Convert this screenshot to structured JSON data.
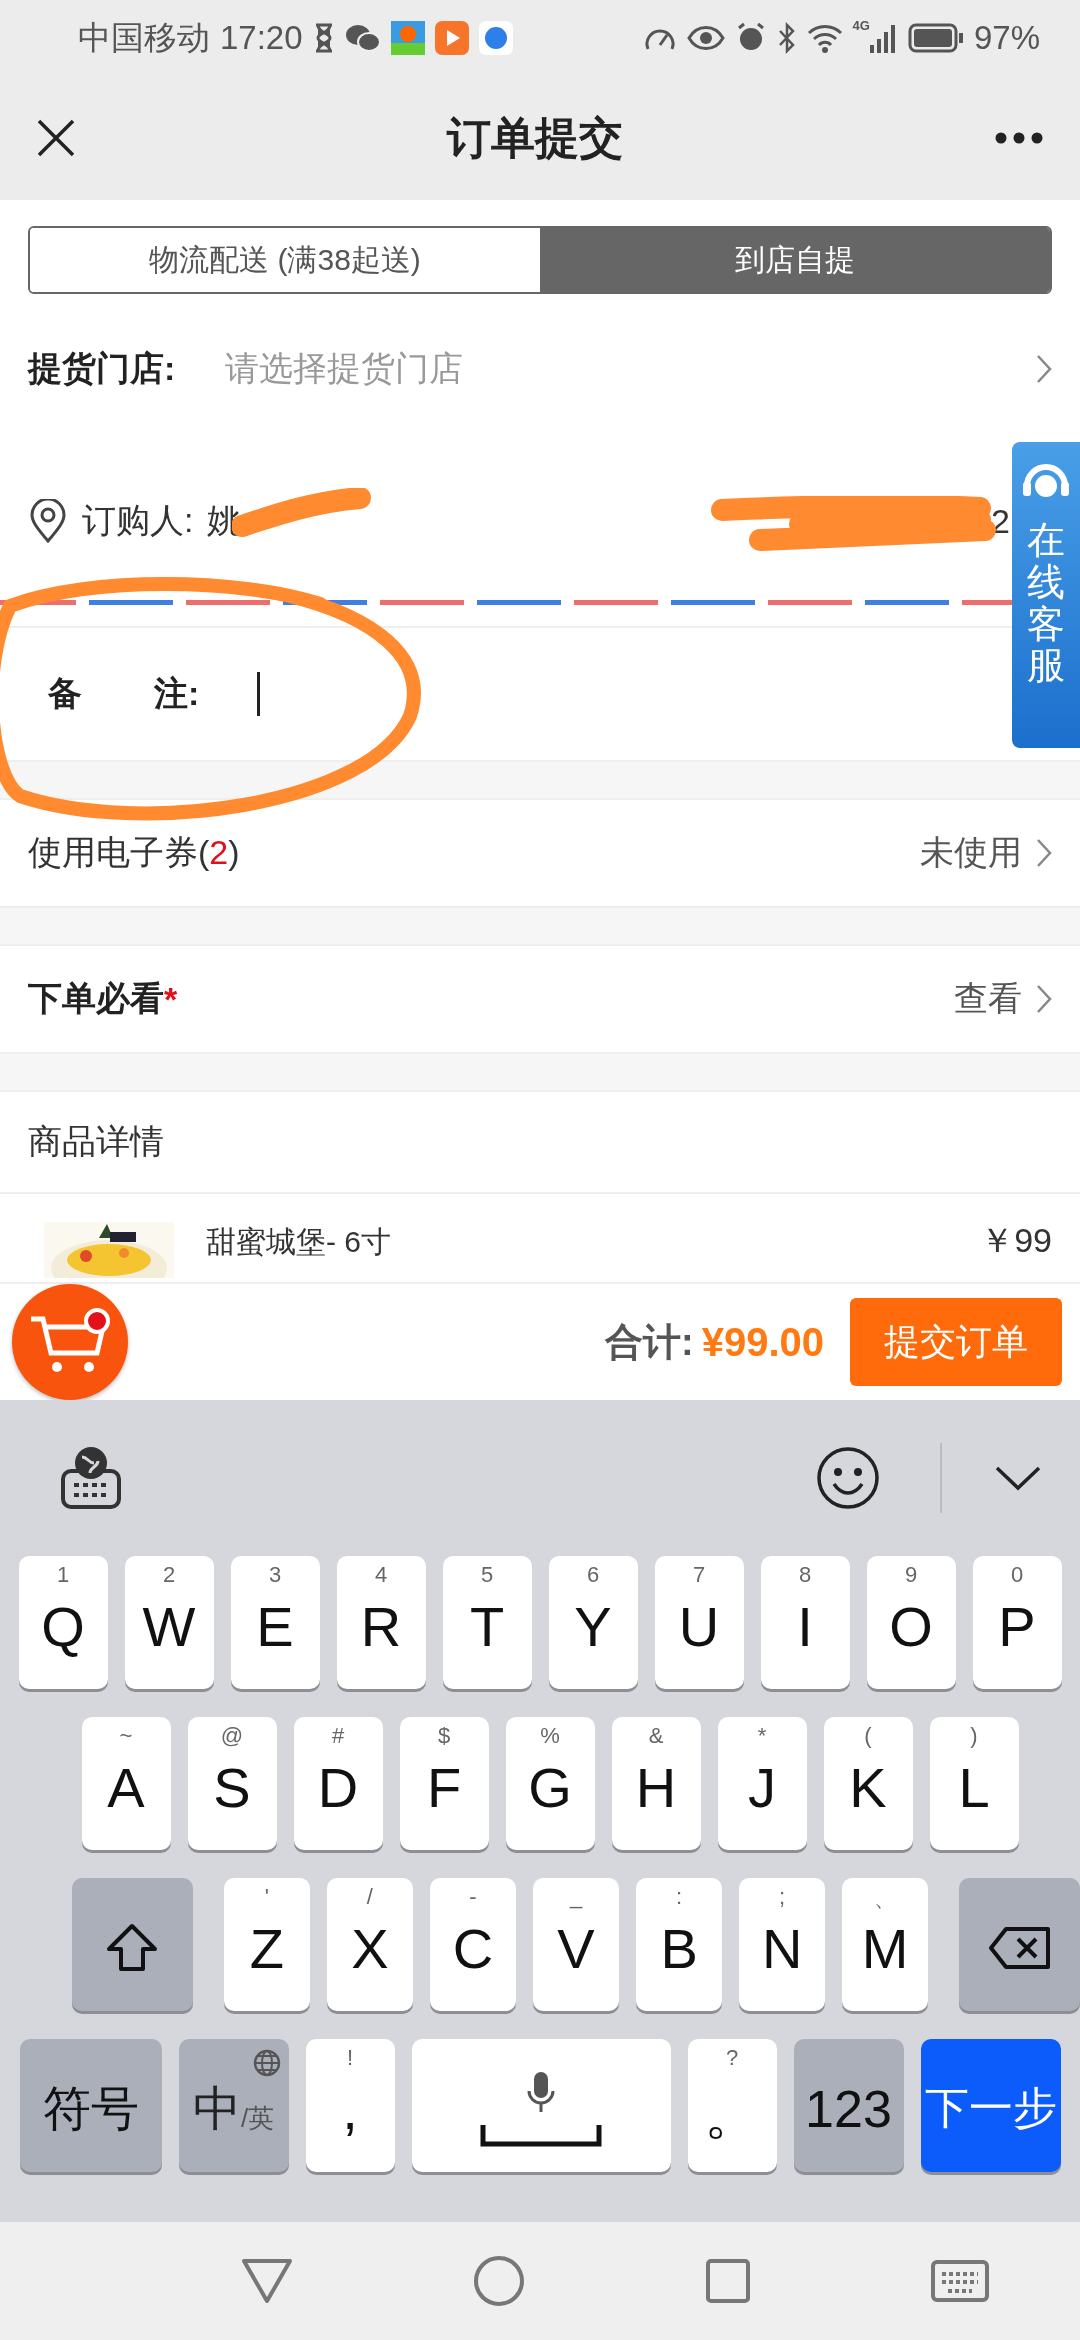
{
  "status_bar": {
    "carrier": "中国移动",
    "time": "17:20",
    "network": "4G",
    "battery": "97%"
  },
  "header": {
    "title": "订单提交"
  },
  "tabs": [
    {
      "label": "物流配送 (满38起送)",
      "selected": false
    },
    {
      "label": "到店自提",
      "selected": true
    }
  ],
  "store": {
    "label": "提货门店:",
    "placeholder": "请选择提货门店"
  },
  "buyer": {
    "label": "订购人:",
    "name": "姚",
    "phone": "2"
  },
  "remark": {
    "label_1": "备",
    "label_2": "注:"
  },
  "coupon": {
    "label": "使用电子券(**2**)",
    "value": "未使用"
  },
  "notice": {
    "label": "下单必看",
    "required": "*",
    "value": "查看"
  },
  "goods": {
    "title": "商品详情",
    "items": [
      {
        "name": "甜蜜城堡- 6寸",
        "price": "￥99"
      }
    ]
  },
  "service_button": {
    "label": "在线客服"
  },
  "footer": {
    "total_label": "合计:",
    "total": "¥99.00",
    "submit": "提交订单",
    "cart_badge": true
  },
  "keyboard": {
    "rows": [
      [
        {
          "label": "Q",
          "hint": "1"
        },
        {
          "label": "W",
          "hint": "2"
        },
        {
          "label": "E",
          "hint": "3"
        },
        {
          "label": "R",
          "hint": "4"
        },
        {
          "label": "T",
          "hint": "5"
        },
        {
          "label": "Y",
          "hint": "6"
        },
        {
          "label": "U",
          "hint": "7"
        },
        {
          "label": "I",
          "hint": "8"
        },
        {
          "label": "O",
          "hint": "9"
        },
        {
          "label": "P",
          "hint": "0"
        }
      ],
      [
        {
          "label": "A",
          "hint": "~"
        },
        {
          "label": "S",
          "hint": "@"
        },
        {
          "label": "D",
          "hint": "#"
        },
        {
          "label": "F",
          "hint": "$"
        },
        {
          "label": "G",
          "hint": "%"
        },
        {
          "label": "H",
          "hint": "&"
        },
        {
          "label": "J",
          "hint": "*"
        },
        {
          "label": "K",
          "hint": "("
        },
        {
          "label": "L",
          "hint": ")"
        }
      ],
      [
        {
          "label": "Z",
          "hint": "'"
        },
        {
          "label": "X",
          "hint": "/"
        },
        {
          "label": "C",
          "hint": "-"
        },
        {
          "label": "V",
          "hint": "_"
        },
        {
          "label": "B",
          "hint": ":"
        },
        {
          "label": "N",
          "hint": ";"
        },
        {
          "label": "M",
          "hint": "、"
        }
      ]
    ],
    "symbols": "符号",
    "lang_main": "中",
    "lang_alt": "/英",
    "comma": ",",
    "comma_hint": "!",
    "period": "。",
    "period_hint": "?",
    "numbers": "123",
    "next": "下一步"
  }
}
